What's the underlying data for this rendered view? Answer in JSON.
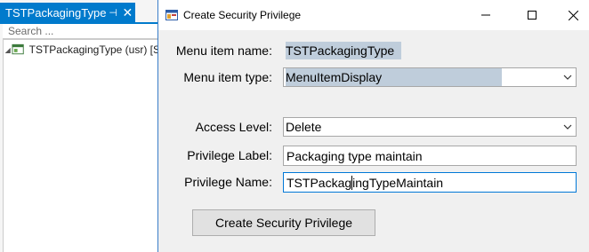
{
  "left_panel": {
    "tab_title": "TSTPackagingType",
    "pin_glyph": "⊣",
    "close_glyph": "✕",
    "search_placeholder": "Search ...",
    "tree_item_label": "TSTPackagingType (usr) [S"
  },
  "dialog": {
    "title": "Create Security Privilege",
    "labels": {
      "menu_item_name": "Menu item name:",
      "menu_item_type": "Menu item type:",
      "access_level": "Access Level:",
      "privilege_label": "Privilege Label:",
      "privilege_name": "Privilege Name:"
    },
    "values": {
      "menu_item_name": "TSTPackagingType",
      "menu_item_type": "MenuItemDisplay",
      "access_level": "Delete",
      "privilege_label": "Packaging type maintain",
      "privilege_name_before_caret": "TSTPackag",
      "privilege_name_after_caret": "ingTypeMaintain"
    },
    "create_button_label": "Create Security Privilege"
  },
  "colors": {
    "accent": "#007acc",
    "selection": "#bfcddb",
    "focus_border": "#0078d7"
  },
  "icons": {
    "window_icon": "app-window-icon",
    "tree_icon": "menu-item-icon",
    "dropdown": "chevron-down-icon"
  }
}
